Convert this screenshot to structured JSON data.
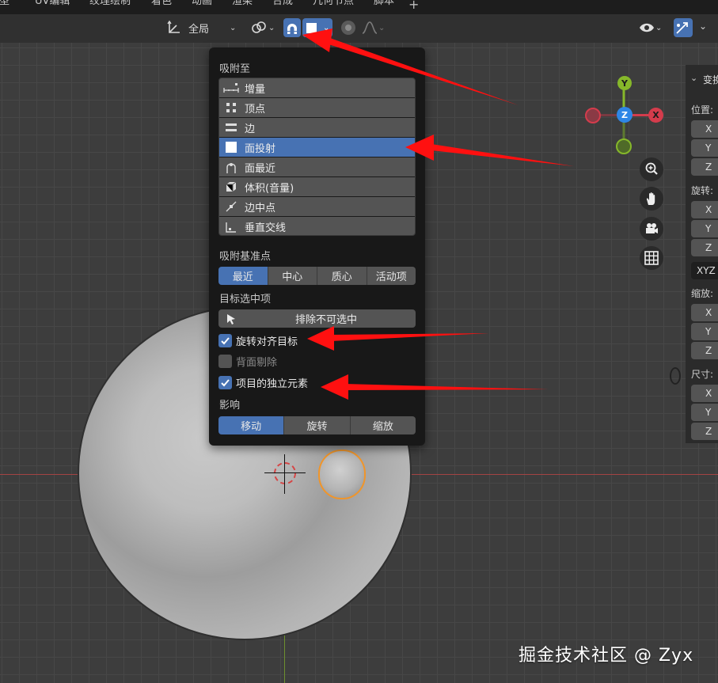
{
  "tabs": [
    "模型",
    "UV编辑",
    "纹理绘制",
    "着色",
    "动画",
    "渲染",
    "合成",
    "几何节点",
    "脚本"
  ],
  "toolbar": {
    "orientation_label": "全局",
    "pivot_icon": "transform-pivot-icon",
    "snap_active": true
  },
  "popover": {
    "snap_to_title": "吸附至",
    "snap_items": [
      {
        "label": "增量",
        "icon": "increment-icon",
        "selected": false
      },
      {
        "label": "顶点",
        "icon": "vertex-icon",
        "selected": false
      },
      {
        "label": "边",
        "icon": "edge-icon",
        "selected": false
      },
      {
        "label": "面投射",
        "icon": "face-project-icon",
        "selected": true
      },
      {
        "label": "面最近",
        "icon": "face-nearest-icon",
        "selected": false
      },
      {
        "label": "体积(音量)",
        "icon": "volume-icon",
        "selected": false
      },
      {
        "label": "边中点",
        "icon": "edge-midpoint-icon",
        "selected": false
      },
      {
        "label": "垂直交线",
        "icon": "perpendicular-icon",
        "selected": false
      }
    ],
    "snap_base_title": "吸附基准点",
    "snap_base_options": [
      "最近",
      "中心",
      "质心",
      "活动项"
    ],
    "snap_base_selected": 0,
    "target_title": "目标选中项",
    "exclude_button": "排除不可选中",
    "rotate_align_label": "旋转对齐目标",
    "rotate_align_checked": true,
    "backface_label": "背面剔除",
    "backface_checked": false,
    "individual_label": "项目的独立元素",
    "individual_checked": true,
    "affect_title": "影响",
    "affect_options": [
      "移动",
      "旋转",
      "缩放"
    ],
    "affect_selected": 0
  },
  "gizmo": {
    "y": "Y",
    "z": "Z",
    "x": "X",
    "colors": {
      "x": "#d43c4c",
      "y": "#86b82a",
      "z": "#2e86e6"
    }
  },
  "npanel": {
    "header": "变换",
    "location_label": "位置:",
    "rotation_label": "旋转:",
    "rotation_mode": "XYZ",
    "scale_label": "缩放:",
    "dimensions_label": "尺寸:",
    "axes": [
      "X",
      "Y",
      "Z"
    ]
  },
  "watermark": "掘金技术社区 @ Zyx",
  "colors": {
    "accent": "#4772b3",
    "arrow": "#ff1010",
    "selection": "#f0952a"
  }
}
